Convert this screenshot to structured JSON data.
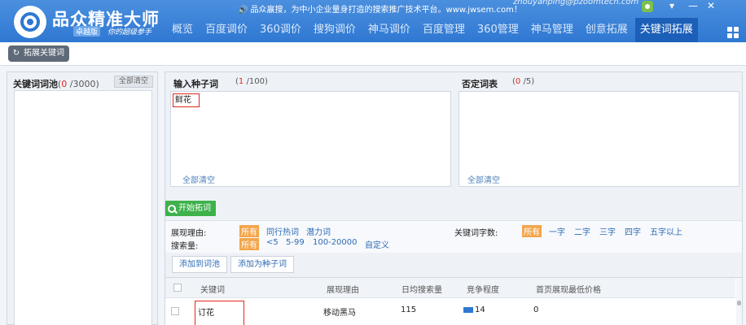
{
  "app": {
    "name": "品众精准大师",
    "edition": "卓越版",
    "slogan": "你的超级参手",
    "announcement": "品众赢搜，为中小企业量身打造的搜索推广技术平台。www.jwsem.com！",
    "user": "zhouyanping@pzoomtech.com",
    "window_controls": [
      "▾",
      "—",
      "✕"
    ]
  },
  "nav": {
    "items": [
      "概览",
      "百度调价",
      "360调价",
      "搜狗调价",
      "神马调价",
      "百度管理",
      "360管理",
      "神马管理",
      "创意拓展",
      "关键词拓展"
    ],
    "active_index": 9
  },
  "toolbar": {
    "expand_label": "拓展关键词"
  },
  "pool": {
    "title": "关键词词池",
    "count": "0",
    "max": "/3000",
    "clear_label": "全部清空"
  },
  "seed": {
    "label": "输入种子词",
    "count": "1",
    "max": "/100",
    "value": "鲜花",
    "clear_label": "全部清空"
  },
  "negative": {
    "label": "否定词表",
    "count": "0",
    "max": "/5",
    "clear_label": "全部清空"
  },
  "start_label": "开始拓词",
  "filters": {
    "reason_label": "展现理由:",
    "reason_options": [
      "所有",
      "同行热词",
      "潜力词"
    ],
    "search_label": "搜索量:",
    "search_options": [
      "所有",
      "<5",
      "5-99",
      "100-20000",
      "自定义"
    ],
    "length_label": "关键词字数:",
    "length_options": [
      "所有",
      "一字",
      "二字",
      "三字",
      "四字",
      "五字以上"
    ]
  },
  "actions": {
    "add_pool": "添加到词池",
    "add_seed": "添加为种子词"
  },
  "table": {
    "headers": [
      "关键词",
      "展现理由",
      "日均搜索量",
      "竞争程度",
      "首页展现最低价格"
    ],
    "rows": [
      {
        "keyword": "订花",
        "reason": "移动黑马",
        "volume": "115",
        "competition": "14",
        "price": "0"
      }
    ]
  },
  "colors": {
    "title_bar": "#3b83d8",
    "active_tab": "#1b5fb8",
    "start_button": "#3eb14b",
    "selected_filter": "#f3a64b",
    "highlight_red": "#e0281d"
  }
}
